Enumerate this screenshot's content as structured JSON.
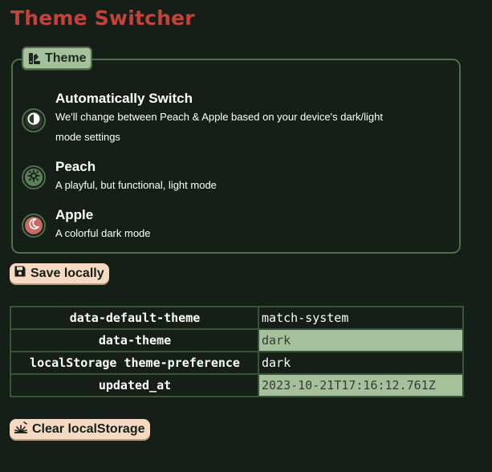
{
  "page": {
    "title": "Theme Switcher"
  },
  "theme_fieldset": {
    "legend": "Theme",
    "legend_icon": "swatches-icon",
    "options": [
      {
        "title": "Automatically Switch",
        "description_line1": "We'll change between Peach & Apple based on your device's dark/light",
        "description_line2": "mode settings",
        "icon": "half-circle-icon",
        "icon_color": "#2c3b2c"
      },
      {
        "title": "Peach",
        "description": "A playful, but functional, light mode",
        "icon": "sun-gear-icon",
        "icon_color": "#5d805a"
      },
      {
        "title": "Apple",
        "description": "A colorful dark mode",
        "icon": "moon-icon",
        "icon_color": "#c86a63"
      }
    ]
  },
  "save_button": {
    "label": "Save locally",
    "icon": "floppy-disk-icon"
  },
  "attributes_table": {
    "rows": [
      {
        "key": "data-default-theme",
        "value": "match-system",
        "highlighted": false
      },
      {
        "key": "data-theme",
        "value": "dark",
        "highlighted": true
      },
      {
        "key": "localStorage theme-preference",
        "value": "dark",
        "highlighted": false
      },
      {
        "key": "updated_at",
        "value": "2023-10-21T17:16:12.761Z",
        "highlighted": true
      }
    ]
  },
  "clear_button": {
    "label": "Clear localStorage",
    "icon": "broom-icon"
  },
  "colors": {
    "background": "#151f17",
    "title": "#c3433a",
    "accent_green": "#a4c19c",
    "border_green": "#4f6e4b",
    "button_peach": "#f6d9c3"
  }
}
